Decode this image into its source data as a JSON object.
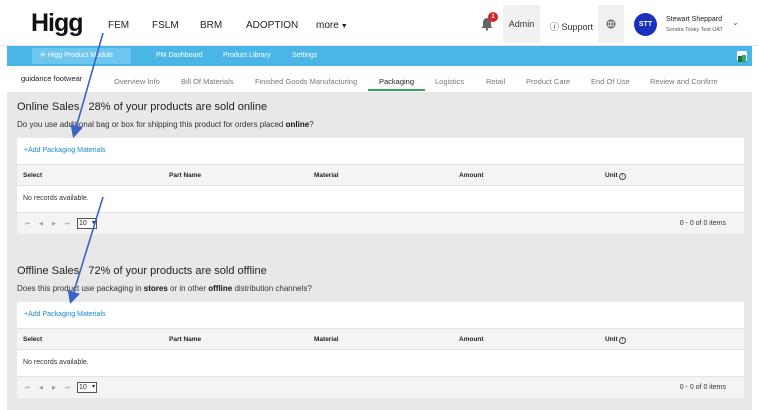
{
  "app": {
    "logo": "Higg",
    "nav": [
      "FEM",
      "FSLM",
      "BRM",
      "ADOPTION",
      "more"
    ],
    "notification_count": "1",
    "admin_label": "Admin",
    "support_label": "Support",
    "user": {
      "initials": "STT",
      "name": "Stewart Sheppard",
      "org": "Sondra Tosky Test UAT"
    }
  },
  "module_bar": {
    "module_label": "Higg Product Module",
    "links": [
      "PM Dashboard",
      "Product Library",
      "Settings"
    ]
  },
  "tabs": {
    "product_name": "guidance footwear",
    "items": [
      "Overview Info",
      "Bill Of Materials",
      "Finished Goods Manufacturing",
      "Packaging",
      "Logistics",
      "Retail",
      "Product Care",
      "End Of Use",
      "Review and Confirm"
    ],
    "active": "Packaging"
  },
  "online": {
    "title_label": "Online Sales",
    "title_percent": "28% of your products are sold online",
    "question_pre": "Do you use additional bag or box for shipping this product for orders placed ",
    "question_bold": "online",
    "question_post": "?",
    "add_link": "+Add Packaging Materials",
    "columns": [
      "Select",
      "Part Name",
      "Material",
      "Amount",
      "Unit"
    ],
    "empty_text": "No records available.",
    "page_size": "10",
    "pager_info": "0 - 0 of 0 items"
  },
  "offline": {
    "title_label": "Offline Sales",
    "title_percent": "72% of your products are sold offline",
    "question_pre": "Does this product use packaging in ",
    "question_bold1": "stores",
    "question_mid": " or in other ",
    "question_bold2": "offline",
    "question_post": " distribution channels?",
    "add_link": "+Add Packaging Materials",
    "columns": [
      "Select",
      "Part Name",
      "Material",
      "Amount",
      "Unit"
    ],
    "empty_text": "No records available.",
    "page_size": "10",
    "pager_info": "0 - 0 of 0 items"
  },
  "icons": {
    "bell": "bell-icon",
    "support": "question-circle-icon",
    "globe": "globe-icon",
    "user_caret": "chevron-down-icon",
    "module": "grid-icon",
    "excel": "excel-icon",
    "info": "info-icon",
    "pager": [
      "first-page-icon",
      "prev-page-icon",
      "next-page-icon",
      "last-page-icon"
    ]
  },
  "colors": {
    "module_bar": "#4ab6e6",
    "active_tab_underline": "#2fa85a",
    "link": "#1d87c9",
    "avatar": "#1b2fbf",
    "badge": "#d9262b",
    "annotation_arrow": "#3a63c4"
  }
}
